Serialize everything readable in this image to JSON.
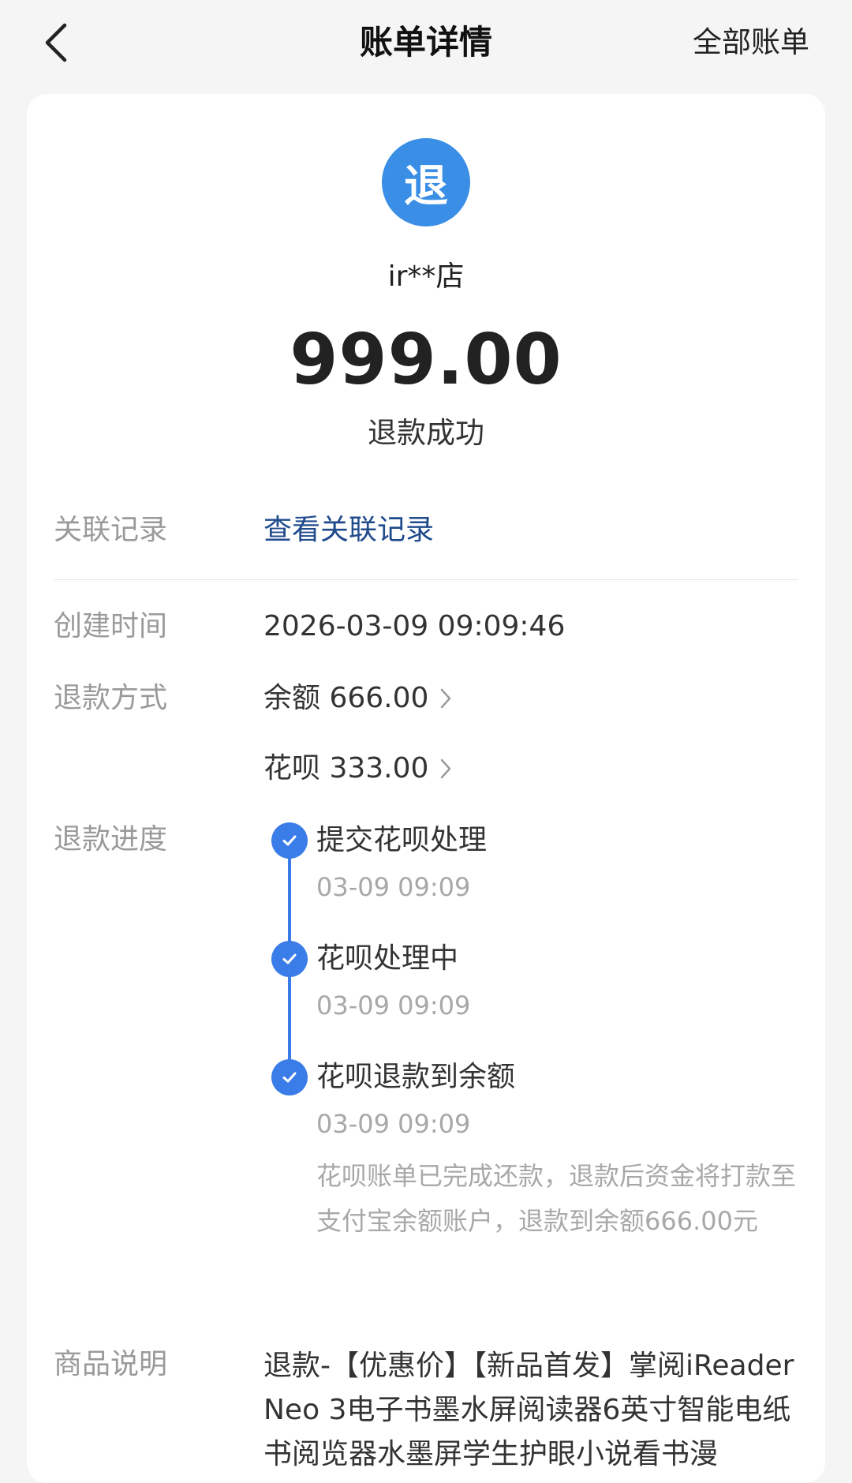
{
  "header": {
    "title": "账单详情",
    "right_link": "全部账单"
  },
  "merchant": {
    "logo_char": "退",
    "name": "ir**店"
  },
  "amount": "999.00",
  "status": "退款成功",
  "related": {
    "label": "关联记录",
    "value": "查看关联记录"
  },
  "created": {
    "label": "创建时间",
    "value": "2026-03-09 09:09:46"
  },
  "refund_method": {
    "label": "退款方式",
    "items": [
      {
        "text": "余额 666.00"
      },
      {
        "text": "花呗 333.00"
      }
    ]
  },
  "progress": {
    "label": "退款进度",
    "steps": [
      {
        "title": "提交花呗处理",
        "time": "03-09 09:09"
      },
      {
        "title": "花呗处理中",
        "time": "03-09 09:09"
      },
      {
        "title": "花呗退款到余额",
        "time": "03-09 09:09"
      }
    ],
    "note": "花呗账单已完成还款，退款后资金将打款至支付宝余额账户，退款到余额666.00元"
  },
  "product": {
    "label": "商品说明",
    "value": "退款-【优惠价】【新品首发】掌阅iReader Neo 3电子书墨水屏阅读器6英寸智能电纸书阅览器水墨屏学生护眼小说看书漫"
  },
  "colors": {
    "accent": "#3a7ce8",
    "logo": "#3a8ee6",
    "link": "#1f4a8c",
    "label": "#9a9a9a",
    "background": "#f5f5f5"
  }
}
